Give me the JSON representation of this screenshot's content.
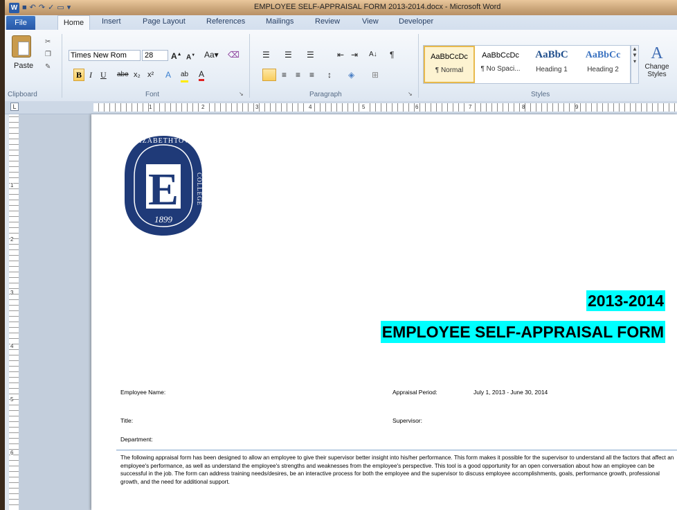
{
  "window": {
    "title": "EMPLOYEE SELF-APPRAISAL FORM 2013-2014.docx - Microsoft Word"
  },
  "tabs": {
    "file": "File",
    "home": "Home",
    "insert": "Insert",
    "page_layout": "Page Layout",
    "references": "References",
    "mailings": "Mailings",
    "review": "Review",
    "view": "View",
    "developer": "Developer"
  },
  "ribbon": {
    "clipboard": {
      "paste_label": "Paste",
      "group_label": "Clipboard"
    },
    "font": {
      "font_name": "Times New Rom",
      "font_size": "28",
      "group_label": "Font"
    },
    "paragraph": {
      "group_label": "Paragraph"
    },
    "styles": {
      "group_label": "Styles",
      "items": [
        {
          "sample": "AaBbCcDc",
          "name": "¶ Normal"
        },
        {
          "sample": "AaBbCcDc",
          "name": "¶ No Spaci..."
        },
        {
          "sample": "AaBbC",
          "name": "Heading 1"
        },
        {
          "sample": "AaBbCc",
          "name": "Heading 2"
        }
      ],
      "change_styles_label": "Change Styles"
    }
  },
  "ruler": {
    "marks": [
      "1",
      "2",
      "3",
      "4",
      "5",
      "6",
      "7",
      "8",
      "9"
    ]
  },
  "document": {
    "logo": {
      "top_text": "ELIZABETHTOWN",
      "side_text": "COLLEGE",
      "letter": "E",
      "year": "1899"
    },
    "year": "2013-2014",
    "title": "EMPLOYEE SELF-APPRAISAL FORM",
    "fields": {
      "employee_name": "Employee Name:",
      "appraisal_period_label": "Appraisal Period:",
      "appraisal_period_value": "July 1, 2013 - June 30, 2014",
      "title": "Title:",
      "supervisor": "Supervisor:",
      "department": "Department:"
    },
    "intro": "The following appraisal form has been designed to allow an employee to give their supervisor better insight into his/her performance.  This form makes it possible for the supervisor to understand all the factors that affect an employee's performance, as well as understand the employee's strengths and weaknesses from the employee's perspective.  This tool is a good opportunity for an open conversation about how an employee can be successful in the job.  The form can address training needs/desires, be an interactive process for both the employee and the supervisor to discuss employee accomplishments, goals, performance growth, professional growth, and the need for additional support."
  },
  "colors": {
    "highlight": "#00ffff",
    "logo_blue": "#1f3a78"
  }
}
